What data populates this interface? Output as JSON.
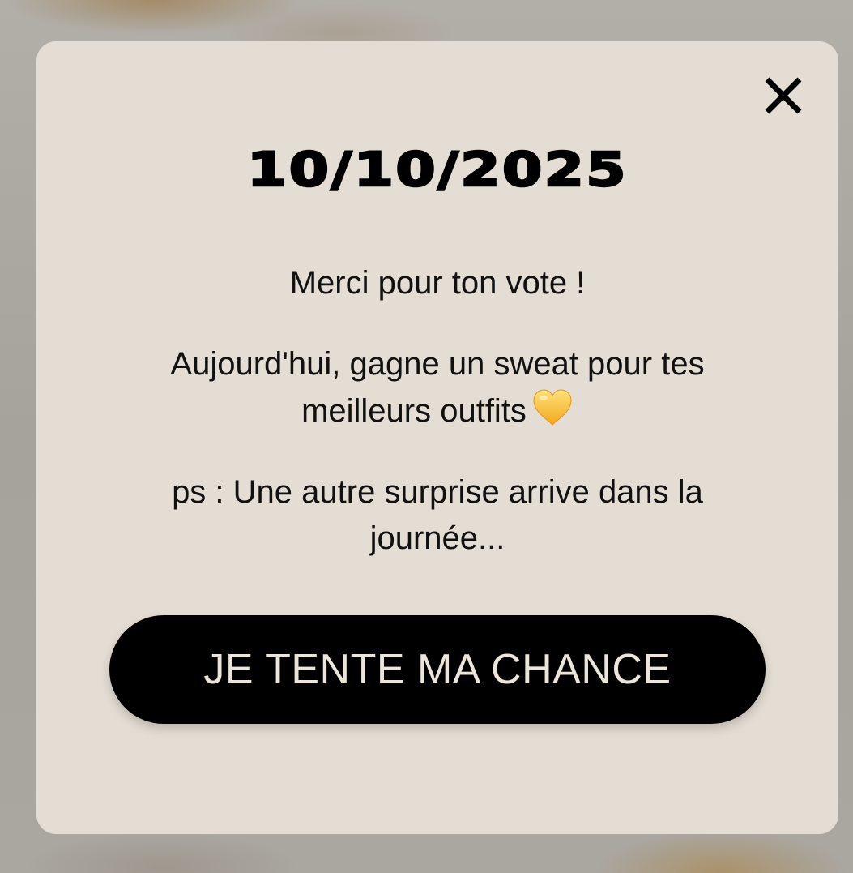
{
  "popup": {
    "date": "10/10/2025",
    "thanks": "Merci pour ton vote !",
    "offer_text": "Aujourd'hui, gagne un sweat pour tes meilleurs outfits",
    "offer_emoji": "yellow-heart-icon",
    "ps_text": "ps : Une autre surprise arrive dans la journée...",
    "cta_label": "JE TENTE MA CHANCE",
    "close_icon": "close-icon"
  },
  "colors": {
    "modal_background": "#e4ddd3",
    "button_background": "#000000",
    "button_text": "#ece5da",
    "heart": "#f5c542"
  }
}
